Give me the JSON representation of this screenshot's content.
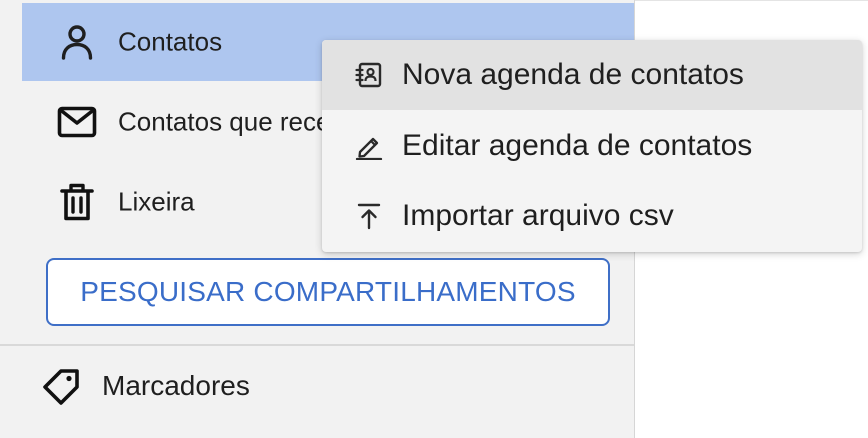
{
  "sidebar": {
    "items": [
      {
        "label": "Contatos",
        "icon": "person-icon",
        "selected": true
      },
      {
        "label": "Contatos que recebi",
        "icon": "envelope-icon",
        "selected": false
      },
      {
        "label": "Lixeira",
        "icon": "trash-icon",
        "selected": false
      }
    ],
    "search_shares_label": "PESQUISAR COMPARTILHAMENTOS",
    "tags_label": "Marcadores",
    "tags_icon": "tag-icon"
  },
  "context_menu": {
    "items": [
      {
        "label": "Nova agenda de contatos",
        "icon": "contact-book-icon",
        "hovered": true
      },
      {
        "label": "Editar agenda de contatos",
        "icon": "pencil-icon",
        "hovered": false
      },
      {
        "label": "Importar arquivo csv",
        "icon": "upload-icon",
        "hovered": false
      }
    ]
  },
  "colors": {
    "selected_bg": "#aec6ef",
    "accent": "#3a6dc9",
    "sidebar_bg": "#f2f2f2",
    "menu_bg": "#f4f4f4",
    "menu_hover_bg": "#e2e2e2"
  }
}
